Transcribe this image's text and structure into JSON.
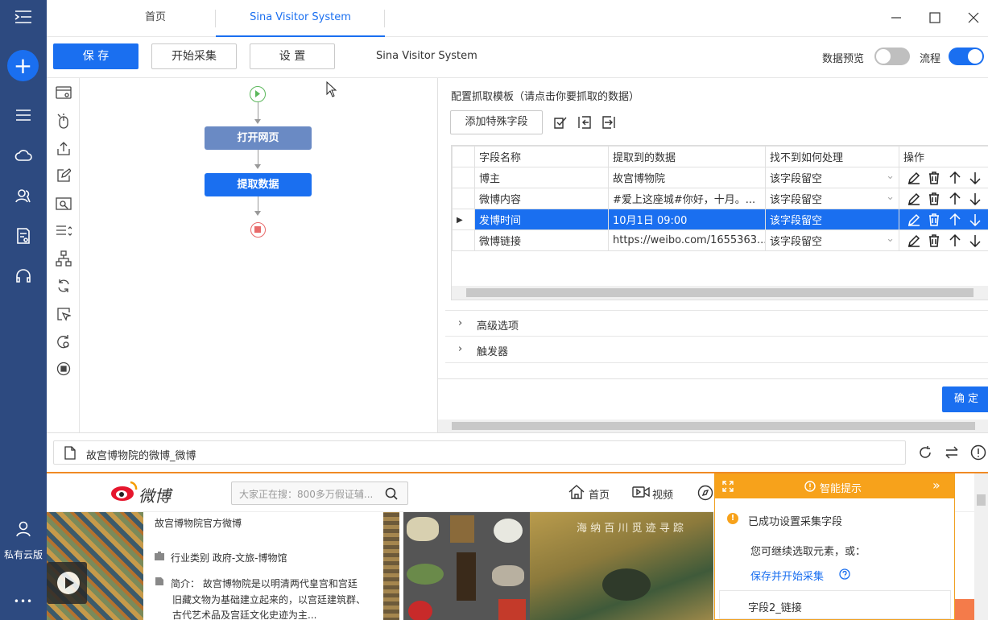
{
  "sidebar": {
    "cloud_label": "私有云版",
    "more": "•••"
  },
  "tabs": {
    "home": "首页",
    "active": "Sina Visitor System"
  },
  "toolbar": {
    "save": "保 存",
    "start": "开始采集",
    "settings": "设 置",
    "task_name": "Sina Visitor System",
    "preview_label": "数据预览",
    "flow_label": "流程",
    "preview_on": false,
    "flow_on": true
  },
  "flow": {
    "node1": "打开网页",
    "node2": "提取数据"
  },
  "config": {
    "title": "配置抓取模板（请点击你要抓取的数据）",
    "add_field": "添加特殊字段",
    "headers": [
      "字段名称",
      "提取到的数据",
      "找不到如何处理",
      "操作"
    ],
    "rows": [
      {
        "name": "博主",
        "value": "故宫博物院",
        "handling": "该字段留空",
        "selected": false
      },
      {
        "name": "微博内容",
        "value": "#爱上这座城#你好，十月。...",
        "handling": "该字段留空",
        "selected": false
      },
      {
        "name": "发博时间",
        "value": "10月1日 09:00",
        "handling": "该字段留空",
        "selected": true
      },
      {
        "name": "微博链接",
        "value": "https://weibo.com/1655363...",
        "handling": "该字段留空",
        "selected": false
      }
    ],
    "advanced": "高级选项",
    "trigger": "触发器",
    "confirm": "确 定"
  },
  "browser": {
    "address": "故宫博物院的微博_微博"
  },
  "weibo": {
    "logo_text": "微博",
    "search_placeholder": "大家正在搜：800多万假证辅...",
    "nav_home": "首页",
    "nav_video": "视频",
    "profile_title": "故宫博物院官方微博",
    "category": "行业类别  政府-文旅-博物馆",
    "intro_line1": "简介：  故宫博物院是以明清两代皇宫和宫廷",
    "intro_line2": "旧藏文物为基础建立起来的，以宫廷建筑群、",
    "intro_line3": "古代艺术品及宫廷文化史迹为主...",
    "painting_caption": "海 纳 百 川   觅 迹 寻 踪"
  },
  "smart_tip": {
    "title": "智能提示",
    "success": "已成功设置采集字段",
    "continue": "您可继续选取元素，或：",
    "save_start": "保存并开始采集",
    "field_item": "字段2_链接"
  },
  "colors": {
    "sidebar": "#2d4a80",
    "primary": "#1a6ff0",
    "flow_node1": "#6a8ac4",
    "accent_orange": "#f7a21b"
  }
}
